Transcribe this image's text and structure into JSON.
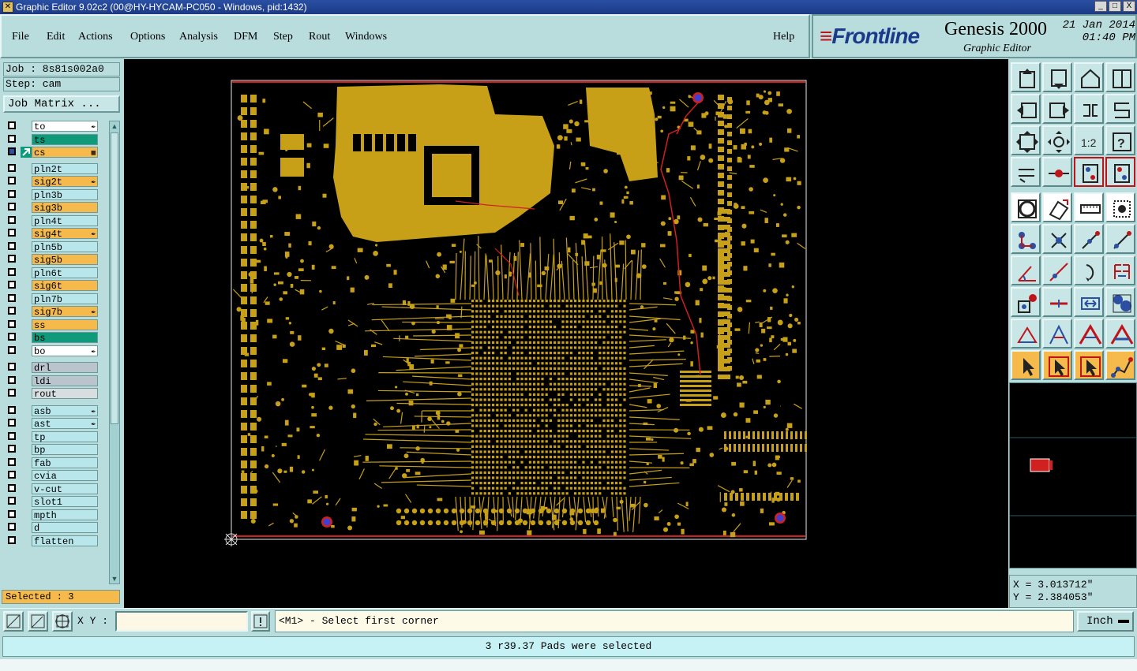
{
  "window": {
    "title": "Graphic Editor 9.02c2 (00@HY-HYCAM-PC050 - Windows, pid:1432)",
    "buttons": [
      "_",
      "□",
      "X"
    ]
  },
  "menu": [
    "File",
    "Edit",
    "Actions",
    "Options",
    "Analysis",
    "DFM",
    "Step",
    "Rout",
    "Windows"
  ],
  "help": "Help",
  "logo": {
    "brand": "Frontline",
    "product": "Genesis 2000",
    "subtitle": "Graphic Editor",
    "date": "21 Jan 2014",
    "time": "01:40 PM"
  },
  "job": {
    "job_label": "Job : 8s81s002a0",
    "step_label": "Step: cam",
    "matrix_button": "Job Matrix ..."
  },
  "layers": [
    {
      "name": "to",
      "color": "white",
      "mark": "pen",
      "checked": false
    },
    {
      "name": "ts",
      "color": "green",
      "mark": "",
      "checked": false
    },
    {
      "name": "cs",
      "color": "orange",
      "mark": "grid",
      "checked": true
    },
    {
      "name": "pln2t",
      "color": "cyan",
      "mark": "",
      "checked": false
    },
    {
      "name": "sig2t",
      "color": "orange",
      "mark": "pen",
      "checked": false
    },
    {
      "name": "pln3b",
      "color": "cyan",
      "mark": "",
      "checked": false
    },
    {
      "name": "sig3b",
      "color": "orange",
      "mark": "",
      "checked": false
    },
    {
      "name": "pln4t",
      "color": "cyan",
      "mark": "",
      "checked": false
    },
    {
      "name": "sig4t",
      "color": "orange",
      "mark": "pen",
      "checked": false
    },
    {
      "name": "pln5b",
      "color": "cyan",
      "mark": "",
      "checked": false
    },
    {
      "name": "sig5b",
      "color": "orange",
      "mark": "",
      "checked": false
    },
    {
      "name": "pln6t",
      "color": "cyan",
      "mark": "",
      "checked": false
    },
    {
      "name": "sig6t",
      "color": "orange",
      "mark": "",
      "checked": false
    },
    {
      "name": "pln7b",
      "color": "cyan",
      "mark": "",
      "checked": false
    },
    {
      "name": "sig7b",
      "color": "orange",
      "mark": "pen",
      "checked": false
    },
    {
      "name": "ss",
      "color": "orange",
      "mark": "",
      "checked": false
    },
    {
      "name": "bs",
      "color": "green",
      "mark": "",
      "checked": false
    },
    {
      "name": "bo",
      "color": "white",
      "mark": "pen",
      "checked": false
    },
    {
      "name": "drl",
      "color": "grey",
      "mark": "",
      "checked": false
    },
    {
      "name": "ldi",
      "color": "grey",
      "mark": "",
      "checked": false
    },
    {
      "name": "rout",
      "color": "lgrey",
      "mark": "",
      "checked": false
    },
    {
      "name": "asb",
      "color": "cyan",
      "mark": "pen",
      "checked": false
    },
    {
      "name": "ast",
      "color": "cyan",
      "mark": "pen",
      "checked": false
    },
    {
      "name": "tp",
      "color": "cyan",
      "mark": "",
      "checked": false
    },
    {
      "name": "bp",
      "color": "cyan",
      "mark": "",
      "checked": false
    },
    {
      "name": "fab",
      "color": "cyan",
      "mark": "",
      "checked": false
    },
    {
      "name": "cvia",
      "color": "cyan",
      "mark": "",
      "checked": false
    },
    {
      "name": "v-cut",
      "color": "cyan",
      "mark": "",
      "checked": false
    },
    {
      "name": "slot1",
      "color": "cyan",
      "mark": "",
      "checked": false
    },
    {
      "name": "mpth",
      "color": "cyan",
      "mark": "",
      "checked": false
    },
    {
      "name": "d",
      "color": "cyan",
      "mark": "",
      "checked": false
    },
    {
      "name": "flatten",
      "color": "cyan",
      "mark": "",
      "checked": false
    }
  ],
  "selected_text": "Selected : 3",
  "coords": {
    "x": "X = 3.013712\"",
    "y": "Y = 2.384053\""
  },
  "xy_label": "X Y :",
  "xy_value": "",
  "prompt": "<M1> - Select first corner",
  "unit": "Inch",
  "status": "3 r39.37 Pads were selected",
  "colors": {
    "copper": "#c8a018",
    "trace_red": "#d02020",
    "pad_blue": "#4040d0",
    "background": "#000000"
  },
  "toolbar_icons": [
    "upload-icon",
    "download-icon",
    "home-icon",
    "split-view-icon",
    "left-arrow-icon",
    "right-arrow-icon",
    "swap-icon",
    "flip-icon",
    "zoom-fit-icon",
    "zoom-center-icon",
    "scale-1-2-icon",
    "help-icon",
    "measure-tools-icon",
    "probe-icon",
    "layer-select-icon",
    "layer-multi-icon",
    "record-icon",
    "edit-shape-icon",
    "ruler-icon",
    "snap-icon",
    "connect-icon",
    "delete-node-icon",
    "add-point-icon",
    "move-point-icon",
    "angle-icon",
    "line-icon",
    "arc-icon",
    "feature-icon",
    "pad-icon",
    "minus-icon",
    "resize-icon",
    "group-icon",
    "triangle-icon",
    "pyramid-icon",
    "pyramid-ext-icon",
    "pyramid-dual-icon",
    "pointer-icon",
    "pointer-select-icon",
    "pointer-box-icon",
    "net-icon"
  ]
}
